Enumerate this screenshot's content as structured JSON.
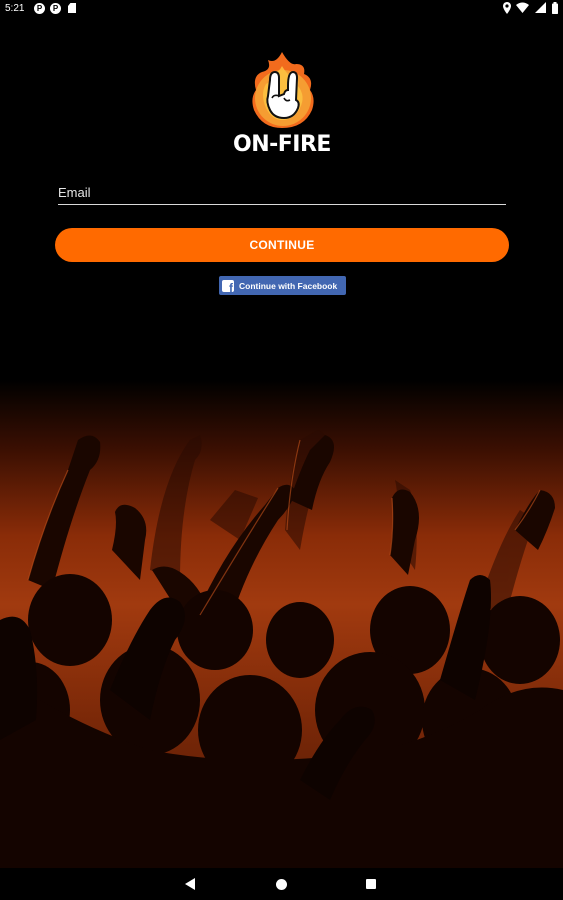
{
  "status_bar": {
    "time": "5:21",
    "notification_icons": [
      "P",
      "P"
    ],
    "right_icons": [
      "location-icon",
      "wifi-icon",
      "signal-icon",
      "battery-icon"
    ]
  },
  "logo": {
    "text": "ON-FIRE",
    "icon": "rock-hand-flame-icon"
  },
  "form": {
    "email_placeholder": "Email",
    "continue_label": "CONTINUE",
    "facebook_label": "Continue with Facebook"
  },
  "colors": {
    "accent": "#ff6a00",
    "facebook": "#4267b2",
    "background": "#000000"
  },
  "nav_bar": {
    "icons": [
      "back-icon",
      "home-icon",
      "recents-icon"
    ]
  }
}
